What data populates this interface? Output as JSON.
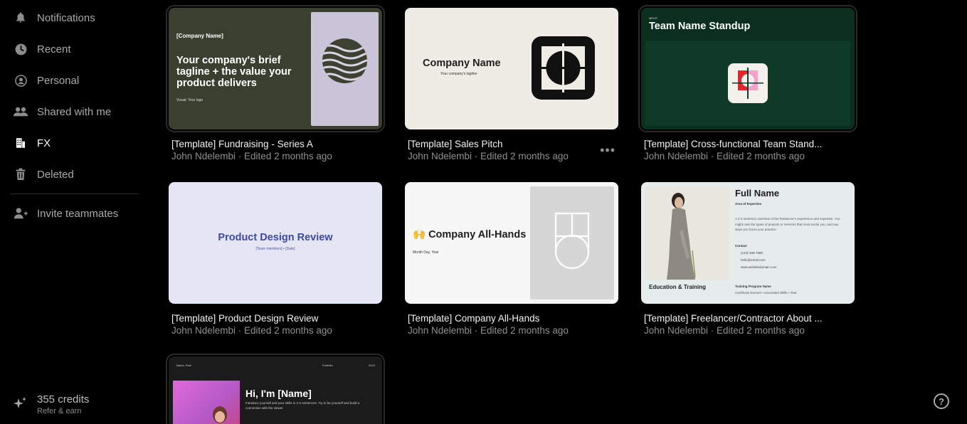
{
  "sidebar": {
    "items": [
      {
        "label": "Notifications",
        "icon": "bell-icon"
      },
      {
        "label": "Recent",
        "icon": "clock-icon"
      },
      {
        "label": "Personal",
        "icon": "person-circle-icon"
      },
      {
        "label": "Shared with me",
        "icon": "people-icon"
      },
      {
        "label": "FX",
        "icon": "building-icon"
      },
      {
        "label": "Deleted",
        "icon": "trash-icon"
      }
    ],
    "invite": {
      "label": "Invite teammates",
      "icon": "add-person-icon"
    },
    "credits": {
      "count": "355 credits",
      "sub": "Refer & earn",
      "icon": "sparkle-icon"
    }
  },
  "cards": [
    {
      "title": "[Template] Fundraising - Series A",
      "meta": "John Ndelembi · Edited 2 months ago",
      "thumb": {
        "company": "[Company Name]",
        "tagline": "Your company's brief tagline + the value your product delivers",
        "visual": "Visual: Your logo"
      }
    },
    {
      "title": "[Template] Sales Pitch",
      "meta": "John Ndelembi · Edited 2 months ago",
      "more": "•••",
      "thumb": {
        "company": "Company Name",
        "tagline": "Your company's tagline"
      }
    },
    {
      "title": "[Template] Cross-functional Team Stand...",
      "meta": "John Ndelembi · Edited 2 months ago",
      "thumb": {
        "small": "MEVIT",
        "title": "Team Name Standup"
      }
    },
    {
      "title": "[Template] Product Design Review",
      "meta": "John Ndelembi · Edited 2 months ago",
      "thumb": {
        "title": "Product Design Review",
        "sub": "[Team members] • [Date]"
      }
    },
    {
      "title": "[Template] Company All-Hands",
      "meta": "John Ndelembi · Edited 2 months ago",
      "thumb": {
        "title": "🙌 Company All-Hands",
        "date": "Month Day, Year"
      }
    },
    {
      "title": "[Template] Freelancer/Contractor About ...",
      "meta": "John Ndelembi · Edited 2 months ago",
      "thumb": {
        "name": "Full Name",
        "area": "Area of Expertise",
        "para": "A 2-3 sentence overview of the freelancer's experience and expertise. You might note the types of projects or services that most excite you, and any ways you focus your practice.",
        "contact": "Contact",
        "phone": "(123)-456-7890",
        "email": "hello@email.com",
        "site": "www.websitedomain.com",
        "edu": "Education & Training",
        "program": "Training Program Name",
        "cert": "Certificate Earned • Associated Skills • Year"
      }
    },
    {
      "thumb": {
        "left": "Name, Role",
        "mid": "Portfolio",
        "right": "2023",
        "hi": "Hi, I'm [Name]",
        "intro": "Introduce yourself and your skills in 2-3 sentences. Try to be yourself and build a connection with the viewer."
      }
    }
  ],
  "help": {
    "label": "?"
  }
}
